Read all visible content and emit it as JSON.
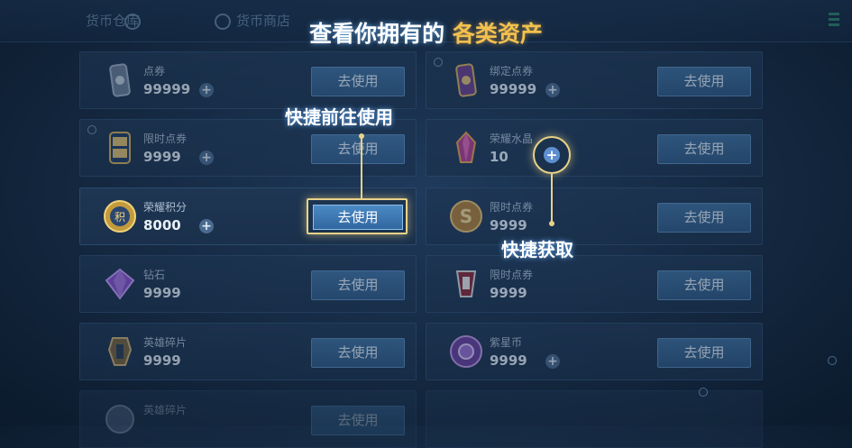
{
  "headline": {
    "main": "查看你拥有的",
    "accent": "各类资产"
  },
  "tabs": [
    {
      "label": "货币仓库"
    },
    {
      "label": "货币商店"
    }
  ],
  "button_label": "去使用",
  "plus_label": "+",
  "callouts": {
    "quick_go": "快捷前往使用",
    "quick_get": "快捷获取"
  },
  "left_column": [
    {
      "name": "点券",
      "qty": "99999",
      "icon": "voucher-icon"
    },
    {
      "name": "限时点券",
      "qty": "9999",
      "icon": "timed-voucher-icon"
    },
    {
      "name": "荣耀积分",
      "qty": "8000",
      "icon": "honor-points-icon"
    },
    {
      "name": "钻石",
      "qty": "9999",
      "icon": "diamond-icon"
    },
    {
      "name": "英雄碎片",
      "qty": "9999",
      "icon": "hero-fragment-icon"
    },
    {
      "name": "英雄碎片",
      "qty": "",
      "icon": "hero-fragment-icon"
    }
  ],
  "right_column": [
    {
      "name": "绑定点券",
      "qty": "99999",
      "icon": "bound-voucher-icon"
    },
    {
      "name": "荣耀水晶",
      "qty": "10",
      "icon": "honor-crystal-icon"
    },
    {
      "name": "限时点券",
      "qty": "9999",
      "icon": "timed-coupon-gold-icon"
    },
    {
      "name": "限时点券",
      "qty": "9999",
      "icon": "timed-coupon-red-icon"
    },
    {
      "name": "紫星币",
      "qty": "9999",
      "icon": "purple-star-coin-icon"
    }
  ],
  "colors": {
    "accent_gold": "#e9d287",
    "button_blue": "#3266a0",
    "headline_accent": "#f2c14e"
  }
}
